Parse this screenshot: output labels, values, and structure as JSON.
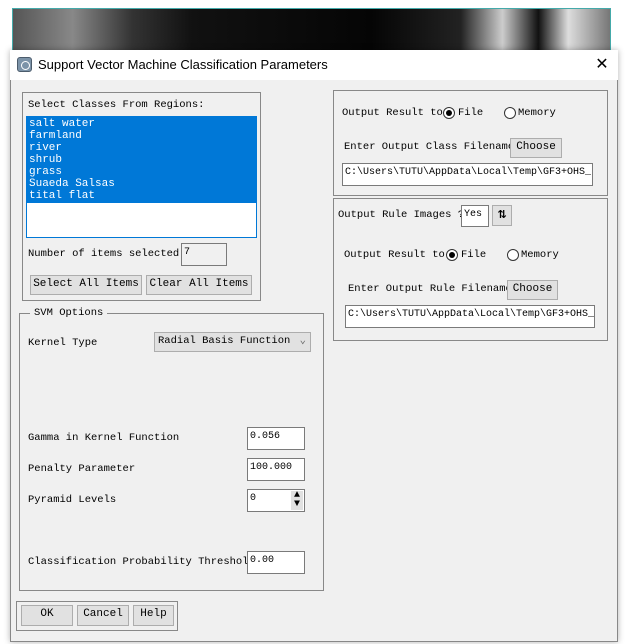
{
  "window": {
    "title": "Support Vector Machine Classification Parameters",
    "close_icon": "close-icon"
  },
  "classes": {
    "label": "Select Classes From Regions:",
    "items": [
      "salt water",
      "farmland",
      "river",
      "shrub",
      "grass",
      "Suaeda Salsas",
      "tital flat"
    ],
    "selected_color": "#0078d7",
    "count_label": "Number of items selected:",
    "count": "7",
    "select_all": "Select All Items",
    "clear_all": "Clear All Items"
  },
  "svm": {
    "legend": "SVM Options",
    "kernel_label": "Kernel Type",
    "kernel_value": "Radial Basis Function",
    "gamma_label": "Gamma in Kernel Function",
    "gamma": "0.056",
    "penalty_label": "Penalty Parameter",
    "penalty": "100.000",
    "pyramid_label": "Pyramid Levels",
    "pyramid": "0",
    "threshold_label": "Classification Probability Threshold",
    "threshold": "0.00"
  },
  "output_class": {
    "result_label": "Output Result to",
    "file": "File",
    "memory": "Memory",
    "selected": "File",
    "filename_label": "Enter Output Class Filename",
    "choose": "Choose",
    "path": "C:\\Users\\TUTU\\AppData\\Local\\Temp\\GF3+OHS_"
  },
  "output_rule": {
    "rule_label": "Output Rule Images ?",
    "rule_value": "Yes",
    "result_label": "Output Result to",
    "file": "File",
    "memory": "Memory",
    "selected": "File",
    "filename_label": "Enter Output Rule Filename",
    "choose": "Choose",
    "path": "C:\\Users\\TUTU\\AppData\\Local\\Temp\\GF3+OHS_"
  },
  "footer": {
    "ok": "OK",
    "cancel": "Cancel",
    "help": "Help"
  }
}
